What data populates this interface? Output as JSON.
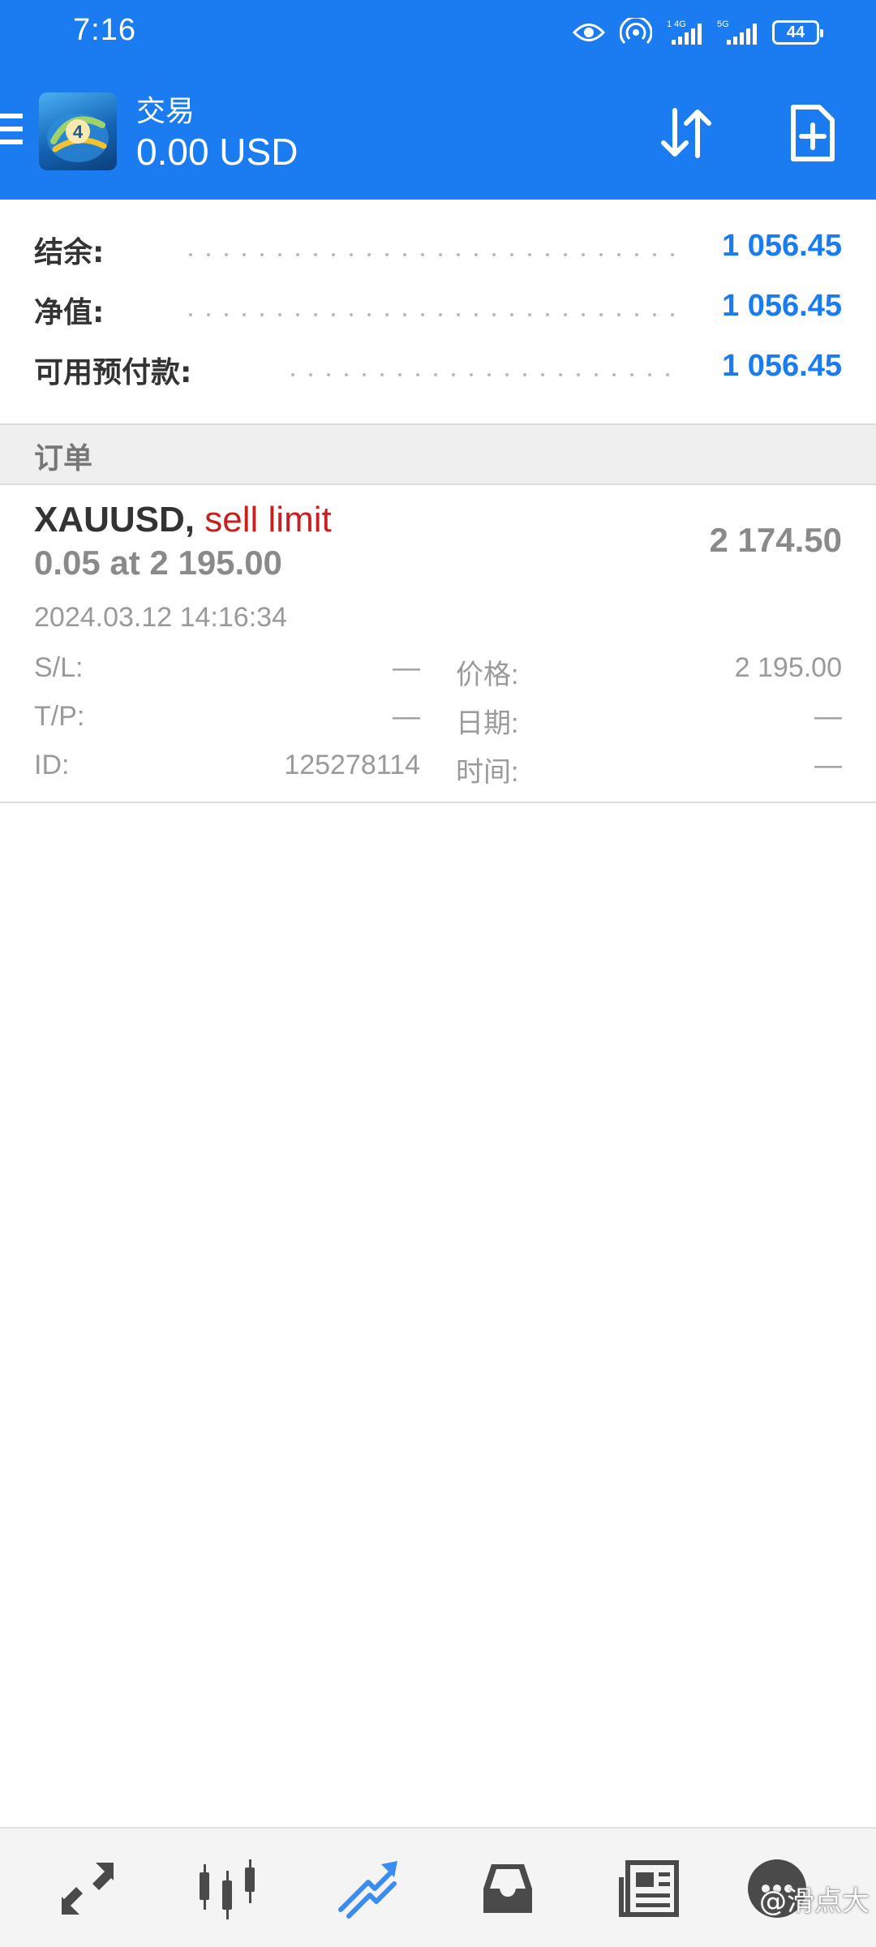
{
  "status_bar": {
    "time": "7:16",
    "battery": "44",
    "net1": "4G",
    "net2": "5G"
  },
  "toolbar": {
    "title": "交易",
    "balance": "0.00 USD",
    "menu_icon": "hamburger-menu-icon",
    "sort_icon": "sort-arrows-icon",
    "new_order_icon": "document-plus-icon"
  },
  "account": {
    "rows": [
      {
        "label": "结余:",
        "value": "1 056.45"
      },
      {
        "label": "净值:",
        "value": "1 056.45"
      },
      {
        "label": "可用预付款:",
        "value": "1 056.45"
      }
    ]
  },
  "orders_section": {
    "title": "订单"
  },
  "order": {
    "symbol": "XAUUSD,",
    "type": "sell limit",
    "volume_line": "0.05 at 2 195.00",
    "current_price": "2 174.50",
    "datetime": "2024.03.12 14:16:34",
    "sl_label": "S/L:",
    "sl_value": "—",
    "tp_label": "T/P:",
    "tp_value": "—",
    "id_label": "ID:",
    "id_value": "125278114",
    "price_label": "价格:",
    "price_value": "2 195.00",
    "date_label": "日期:",
    "date_value": "—",
    "time_label": "时间:",
    "time_value": "—"
  },
  "bottom_nav": {
    "items": [
      "quotes-icon",
      "chart-icon",
      "trade-icon",
      "history-icon",
      "news-icon",
      "chat-icon"
    ],
    "watermark": "@滑点大"
  },
  "colors": {
    "primary": "#1a7cf0",
    "sell": "#c62121",
    "muted": "#8a8a8a"
  }
}
